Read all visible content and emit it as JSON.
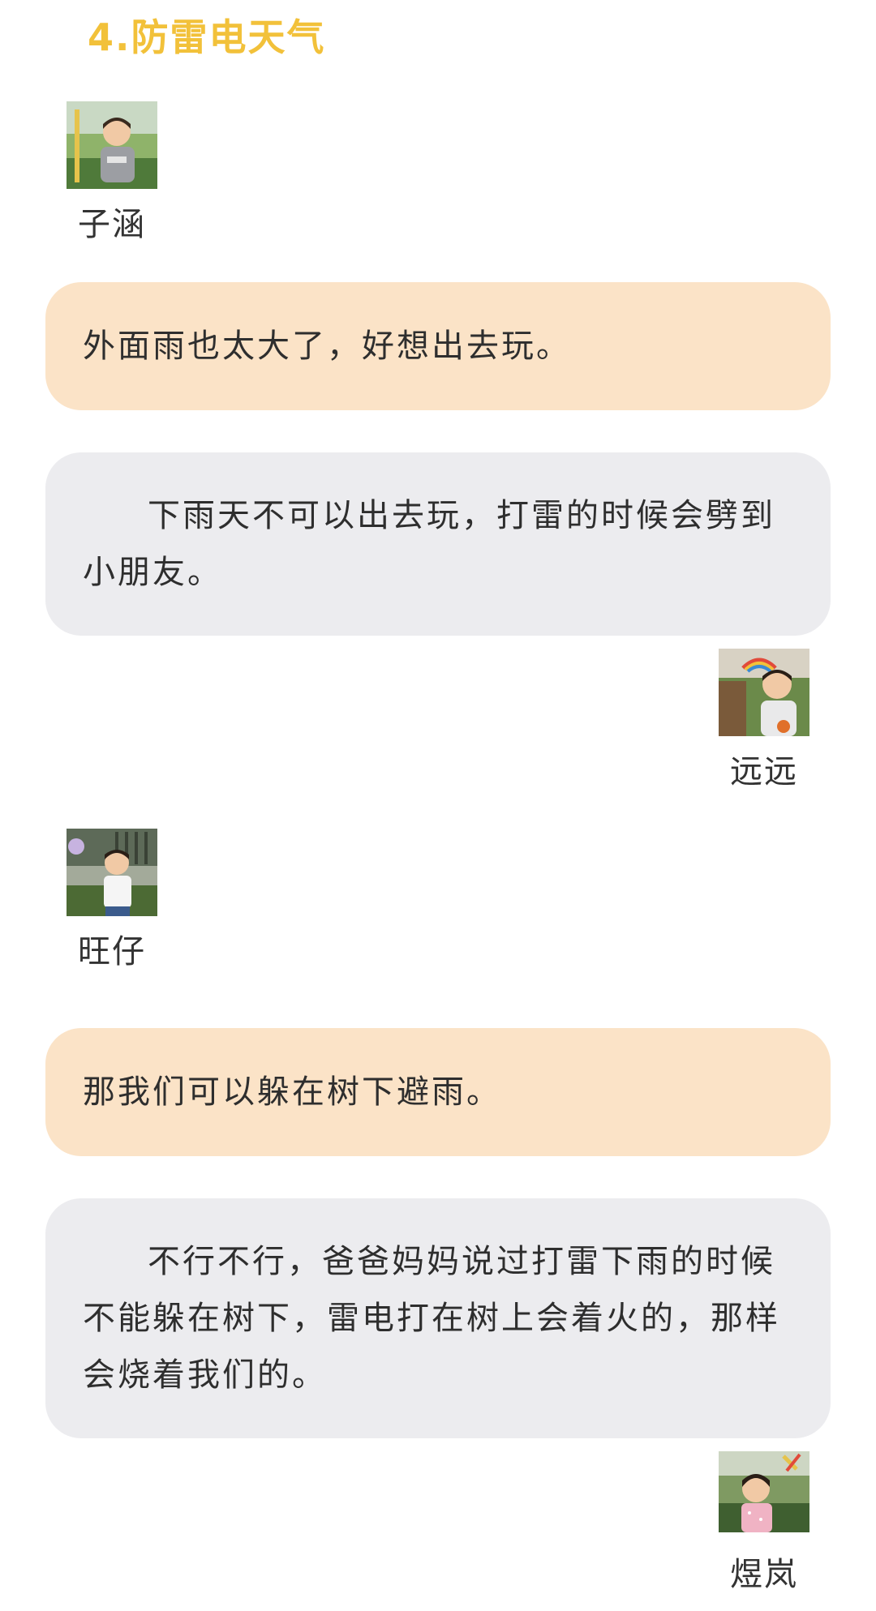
{
  "section": {
    "title": "4.防雷电天气"
  },
  "messages": [
    {
      "speaker": "子涵",
      "side": "left",
      "avatar_icon": "child-photo-avatar",
      "bubble_color": "#fbe3c7",
      "text": "外面雨也太大了，好想出去玩。"
    },
    {
      "speaker": "远远",
      "side": "right",
      "avatar_icon": "child-photo-avatar",
      "bubble_color": "#ececef",
      "text": "下雨天不可以出去玩，打雷的时候会劈到小朋友。"
    },
    {
      "speaker": "旺仔",
      "side": "left",
      "avatar_icon": "child-photo-avatar",
      "bubble_color": "#fbe3c7",
      "text": "那我们可以躲在树下避雨。"
    },
    {
      "speaker": "煜岚",
      "side": "right",
      "avatar_icon": "child-photo-avatar",
      "bubble_color": "#ececef",
      "text": "不行不行，爸爸妈妈说过打雷下雨的时候不能躲在树下，雷电打在树上会着火的，那样会烧着我们的。"
    }
  ],
  "colors": {
    "title": "#f2c13a",
    "bubble_orange": "#fbe3c7",
    "bubble_gray": "#ececef",
    "text": "#2e2e2e"
  }
}
